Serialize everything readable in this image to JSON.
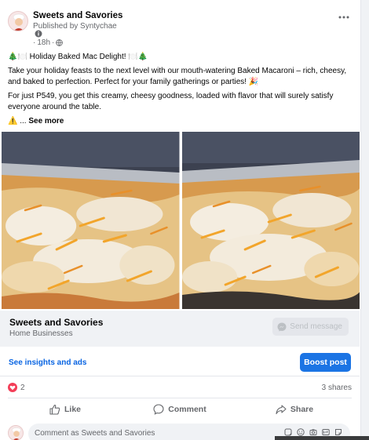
{
  "post": {
    "page_name": "Sweets and Savories",
    "published_by": "Published by Syntychae",
    "time": "18h",
    "title_line": "🎄🍽️ Holiday Baked Mac Delight! 🍽️🎄",
    "paragraph1": "Take your holiday feasts to the next level with our mouth-watering Baked Macaroni – rich, cheesy, and baked to perfection. Perfect for your family gatherings or parties! 🎉",
    "paragraph2": "For just P549, you get this creamy, cheesy goodness, loaded with flavor that will surely satisfy everyone around the table.",
    "see_more_prefix": "⚠️ ... ",
    "see_more": "See more"
  },
  "business": {
    "name": "Sweets and Savories",
    "category": "Home Businesses",
    "send_message": "Send message"
  },
  "insights": {
    "link": "See insights and ads",
    "boost": "Boost post"
  },
  "stats": {
    "reactions": "2",
    "shares": "3 shares"
  },
  "actions": {
    "like": "Like",
    "comment": "Comment",
    "share": "Share"
  },
  "comment_box": {
    "placeholder": "Comment as Sweets and Savories"
  },
  "colors": {
    "accent": "#1b74e4",
    "link": "#0864e2",
    "heart": "#f33e58"
  },
  "icons": [
    "more-options-icon",
    "info-icon",
    "globe-icon",
    "messenger-icon",
    "heart-reaction-icon",
    "like-icon",
    "comment-icon",
    "share-icon",
    "sticker-icon",
    "emoji-icon",
    "camera-icon",
    "gif-icon",
    "sticker-alt-icon"
  ]
}
